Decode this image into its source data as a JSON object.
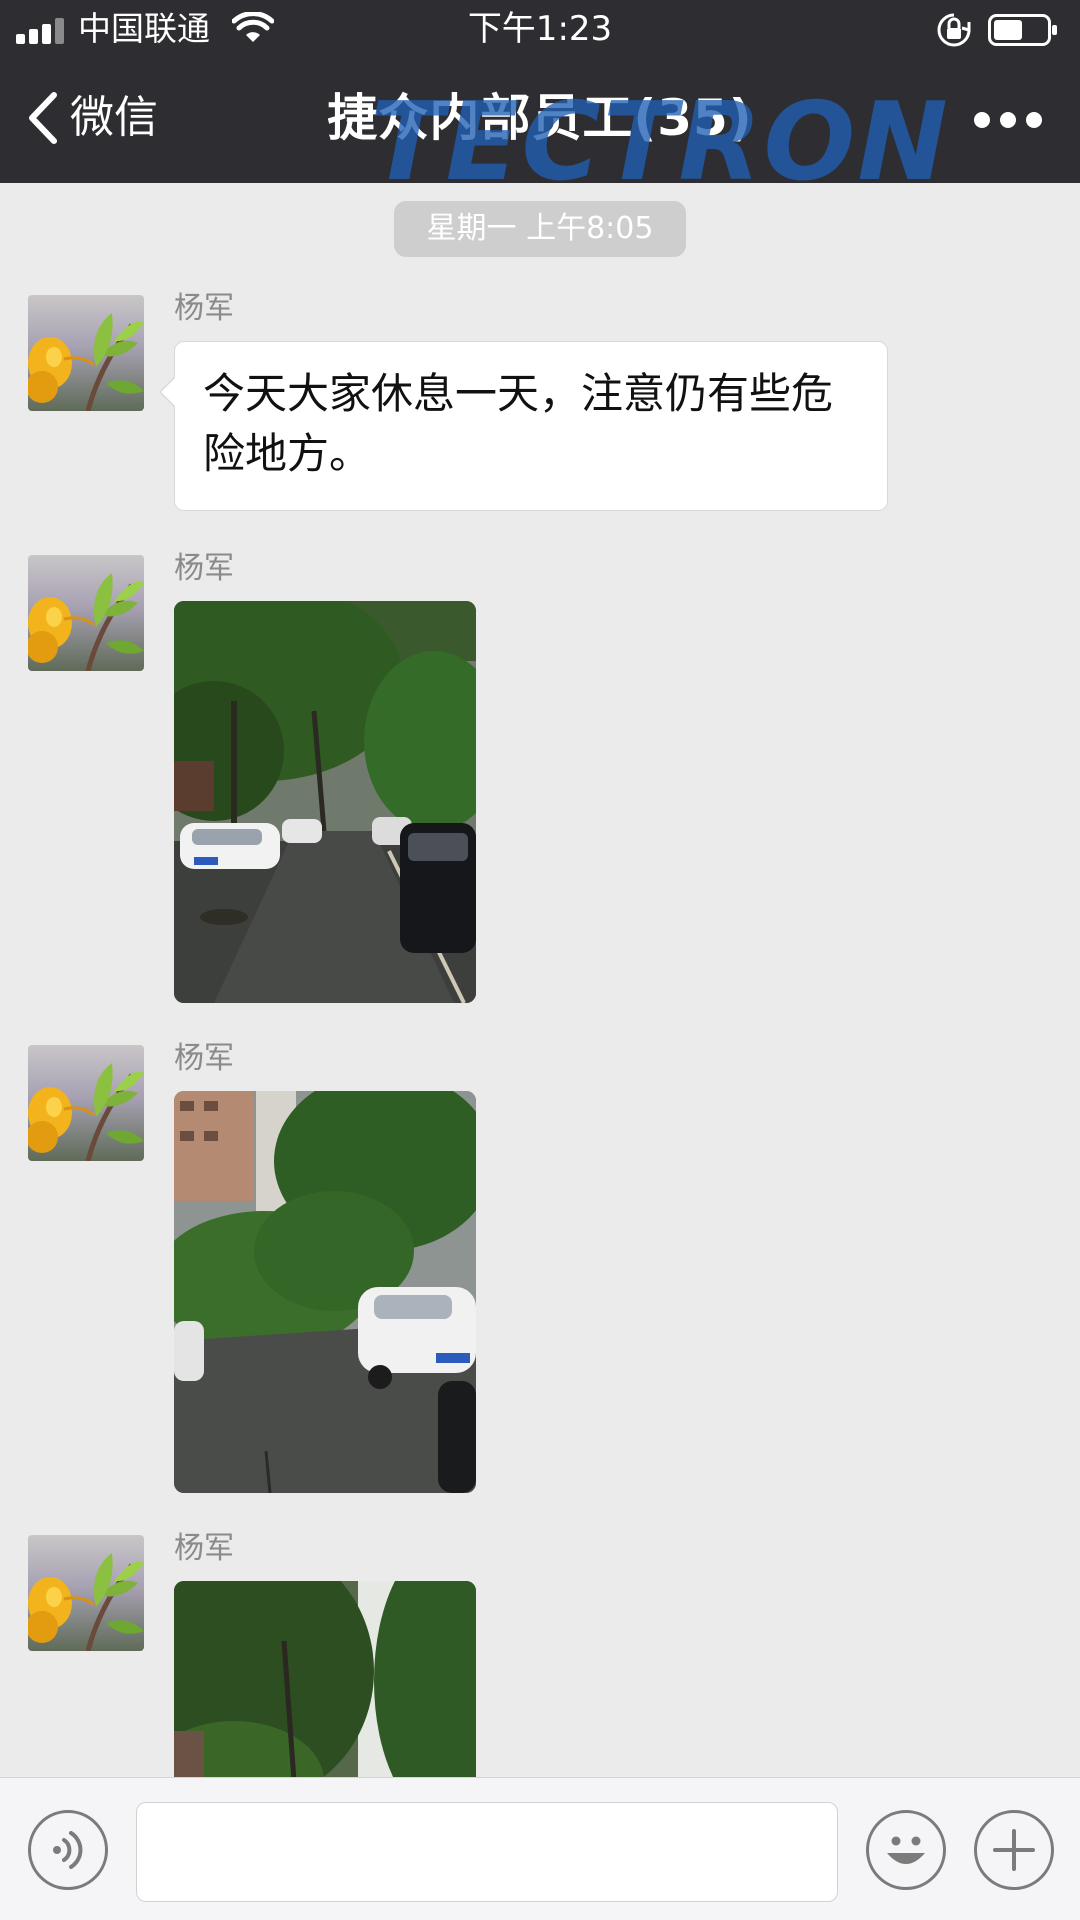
{
  "status_bar": {
    "carrier": "中国联通",
    "time": "下午1:23",
    "signal_bars": 4,
    "battery_level": 0.55,
    "icons": [
      "signal-icon",
      "wifi-icon",
      "rotation-lock-icon",
      "battery-icon"
    ]
  },
  "nav": {
    "back_label": "微信",
    "title": "捷众内部员工(35)",
    "watermark": "TECTRON",
    "icons": [
      "back-chevron-icon",
      "more-icon"
    ]
  },
  "chat": {
    "time_divider": "星期一 上午8:05",
    "messages": [
      {
        "sender": "杨军",
        "type": "text",
        "text": "今天大家休息一天，注意仍有些危险地方。"
      },
      {
        "sender": "杨军",
        "type": "image"
      },
      {
        "sender": "杨军",
        "type": "image"
      },
      {
        "sender": "杨军",
        "type": "image"
      }
    ]
  },
  "input_bar": {
    "value": "",
    "icons": [
      "voice-icon",
      "emoji-icon",
      "plus-icon"
    ]
  },
  "colors": {
    "topbar_bg": "#2e2e32",
    "chat_bg": "#ebebeb",
    "time_pill_bg": "#cecece",
    "watermark": "#1f5fb4"
  }
}
